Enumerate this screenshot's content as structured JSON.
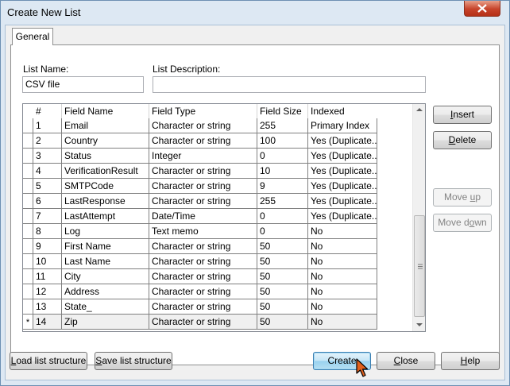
{
  "window": {
    "title": "Create New List"
  },
  "tabs": [
    {
      "label": "General"
    }
  ],
  "form": {
    "list_name_label": "List Name:",
    "list_name_value": "CSV file",
    "list_description_label": "List Description:",
    "list_description_value": ""
  },
  "grid": {
    "columns": [
      "#",
      "Field Name",
      "Field Type",
      "Field Size",
      "Indexed"
    ],
    "rows": [
      {
        "num": "1",
        "name": "Email",
        "type": "Character or string",
        "size": "255",
        "indexed": "Primary Index"
      },
      {
        "num": "2",
        "name": "Country",
        "type": "Character or string",
        "size": "100",
        "indexed": "Yes (Duplicate..."
      },
      {
        "num": "3",
        "name": "Status",
        "type": "Integer",
        "size": "0",
        "indexed": "Yes (Duplicate..."
      },
      {
        "num": "4",
        "name": "VerificationResult",
        "type": "Character or string",
        "size": "10",
        "indexed": "Yes (Duplicate..."
      },
      {
        "num": "5",
        "name": "SMTPCode",
        "type": "Character or string",
        "size": "9",
        "indexed": "Yes (Duplicate..."
      },
      {
        "num": "6",
        "name": "LastResponse",
        "type": "Character or string",
        "size": "255",
        "indexed": "Yes (Duplicate..."
      },
      {
        "num": "7",
        "name": "LastAttempt",
        "type": "Date/Time",
        "size": "0",
        "indexed": "Yes (Duplicate..."
      },
      {
        "num": "8",
        "name": "Log",
        "type": "Text memo",
        "size": "0",
        "indexed": "No"
      },
      {
        "num": "9",
        "name": "First Name",
        "type": "Character or string",
        "size": "50",
        "indexed": "No"
      },
      {
        "num": "10",
        "name": "Last Name",
        "type": "Character or string",
        "size": "50",
        "indexed": "No"
      },
      {
        "num": "11",
        "name": "City",
        "type": "Character or string",
        "size": "50",
        "indexed": "No"
      },
      {
        "num": "12",
        "name": "Address",
        "type": "Character or string",
        "size": "50",
        "indexed": "No"
      },
      {
        "num": "13",
        "name": "State_",
        "type": "Character or string",
        "size": "50",
        "indexed": "No"
      },
      {
        "num": "14",
        "name": "Zip",
        "type": "Character or string",
        "size": "50",
        "indexed": "No"
      }
    ],
    "new_row_marker": "*"
  },
  "side_buttons": {
    "insert": {
      "pre": "",
      "key": "I",
      "post": "nsert"
    },
    "delete": {
      "pre": "",
      "key": "D",
      "post": "elete"
    },
    "move_up": {
      "pre": "Move ",
      "key": "u",
      "post": "p"
    },
    "move_down": {
      "pre": "Move d",
      "key": "o",
      "post": "wn"
    }
  },
  "bottom_buttons": {
    "load": {
      "pre": "",
      "key": "L",
      "post": "oad list structure"
    },
    "save": {
      "pre": "",
      "key": "S",
      "post": "ave list structure"
    },
    "create": "Create",
    "close": {
      "pre": "",
      "key": "C",
      "post": "lose"
    },
    "help": {
      "pre": "",
      "key": "H",
      "post": "elp"
    }
  },
  "colors": {
    "default_button_border": "#3c7fb1",
    "close_button": "#c7432a",
    "selection_row": "#f0f0f0"
  },
  "icons": [
    "close-icon",
    "scroll-up-icon",
    "scroll-down-icon",
    "scroll-grip-icon",
    "mouse-cursor-icon",
    "new-row-icon"
  ]
}
